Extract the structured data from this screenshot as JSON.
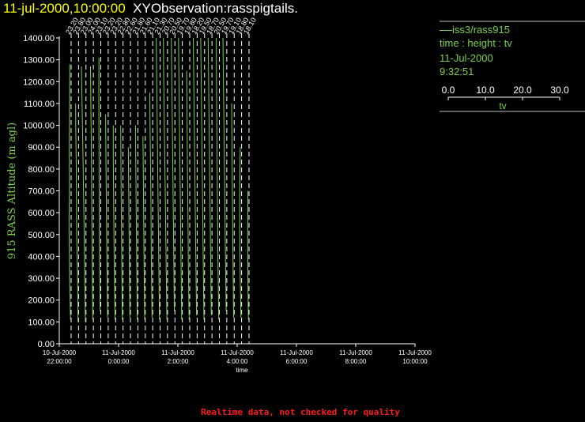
{
  "title": {
    "date": "11-jul-2000,10:00:00",
    "observation": "XYObservation:rasspigtails."
  },
  "legend": {
    "instrument": "iss3/rass915",
    "axes": "time : height : tv",
    "date": "11-Jul-2000",
    "time": "9:32:51",
    "scale_ticks": [
      "0.0",
      "10.0",
      "20.0",
      "30.0"
    ],
    "scale_label": "tv"
  },
  "footer": "Realtime data, not checked for quality",
  "colors": {
    "background": "#000000",
    "trace": "#7ad14a",
    "title_date": "#ffff00",
    "title_observation": "#ffffff",
    "warning": "#ff1a1a",
    "axis_text": "#ffffff",
    "ylabel": "#7ad14a"
  },
  "chart_data": {
    "type": "line",
    "ylabel": "915 RASS Altitude (m agl)",
    "xlabel": "time",
    "ylim": [
      0,
      1400
    ],
    "yticks": [
      "0.00",
      "100.00",
      "200.00",
      "300.00",
      "400.00",
      "500.00",
      "600.00",
      "700.00",
      "800.00",
      "900.00",
      "1000.00",
      "1100.00",
      "1200.00",
      "1300.00",
      "1400.00"
    ],
    "xlim": [
      "2000-07-10 22:00",
      "2000-07-11 10:00"
    ],
    "xticks": [
      {
        "date": "10-Jul-2000",
        "time": "22:00:00"
      },
      {
        "date": "11-Jul-2000",
        "time": "0:00:00"
      },
      {
        "date": "11-Jul-2000",
        "time": "2:00:00"
      },
      {
        "date": "11-Jul-2000",
        "time": "4:00:00"
      },
      {
        "date": "11-Jul-2000",
        "time": "6:00:00"
      },
      {
        "date": "11-Jul-2000",
        "time": "8:00:00"
      },
      {
        "date": "11-Jul-2000",
        "time": "10:00:00"
      }
    ],
    "tv_scale": [
      0,
      30
    ],
    "series": [
      {
        "time": "2000-07-10 22:15",
        "label": "23.20",
        "tv_start": 23.2,
        "profile": [
          [
            0.5,
            110
          ],
          [
            2.5,
            300
          ],
          [
            3.5,
            550
          ],
          [
            2.8,
            700
          ],
          [
            3,
            900
          ],
          [
            2.5,
            1080
          ],
          [
            2,
            1280
          ]
        ]
      },
      {
        "time": "2000-07-10 22:30",
        "label": "23.80",
        "tv_start": 23.8,
        "profile": [
          [
            0.3,
            100
          ],
          [
            1.2,
            300
          ],
          [
            3,
            500
          ],
          [
            3.8,
            800
          ],
          [
            5,
            1000
          ],
          [
            5.2,
            1100
          ]
        ]
      },
      {
        "time": "2000-07-10 22:45",
        "label": "23.00",
        "tv_start": 23.0,
        "profile": [
          [
            0.5,
            100
          ],
          [
            2,
            350
          ],
          [
            3.5,
            600
          ],
          [
            5.5,
            900
          ],
          [
            7,
            1080
          ],
          [
            8.5,
            1270
          ]
        ]
      },
      {
        "time": "2000-07-10 23:00",
        "label": "24.00",
        "tv_start": 24.0,
        "profile": [
          [
            0.5,
            110
          ],
          [
            1.5,
            350
          ],
          [
            2.5,
            600
          ],
          [
            3.5,
            900
          ],
          [
            4.5,
            1150
          ],
          [
            5,
            1270
          ]
        ]
      },
      {
        "time": "2000-07-10 23:15",
        "label": "23.10",
        "tv_start": 23.1,
        "profile": [
          [
            0.5,
            150
          ],
          [
            2,
            400
          ],
          [
            2.5,
            650
          ],
          [
            3,
            900
          ],
          [
            3.2,
            1150
          ],
          [
            3,
            1310
          ]
        ]
      },
      {
        "time": "2000-07-10 23:30",
        "label": "23.20",
        "tv_start": 23.2,
        "profile": [
          [
            0.5,
            120
          ],
          [
            2,
            400
          ],
          [
            3,
            650
          ],
          [
            4,
            900
          ],
          [
            4.5,
            1050
          ]
        ]
      },
      {
        "time": "2000-07-10 23:45",
        "label": "23.20",
        "tv_start": 23.2,
        "profile": [
          [
            0.5,
            110
          ],
          [
            2,
            350
          ],
          [
            3,
            600
          ],
          [
            4,
            850
          ],
          [
            4,
            1000
          ]
        ]
      },
      {
        "time": "2000-07-11 00:00",
        "label": "22.80",
        "tv_start": 22.8,
        "profile": [
          [
            0.5,
            110
          ],
          [
            1.5,
            300
          ],
          [
            2.5,
            550
          ],
          [
            3.5,
            800
          ],
          [
            4,
            1000
          ]
        ]
      },
      {
        "time": "2000-07-11 00:15",
        "label": "22.60",
        "tv_start": 22.6,
        "profile": [
          [
            0.4,
            120
          ],
          [
            1.2,
            300
          ],
          [
            2,
            500
          ],
          [
            3,
            750
          ],
          [
            3.5,
            900
          ]
        ]
      },
      {
        "time": "2000-07-11 00:30",
        "label": "21.80",
        "tv_start": 21.8,
        "profile": [
          [
            0.5,
            110
          ],
          [
            1.5,
            350
          ],
          [
            2.5,
            600
          ],
          [
            3.5,
            850
          ],
          [
            4,
            1000
          ]
        ]
      },
      {
        "time": "2000-07-11 00:45",
        "label": "21.60",
        "tv_start": 21.6,
        "profile": [
          [
            0.5,
            110
          ],
          [
            1.5,
            350
          ],
          [
            2.5,
            600
          ],
          [
            3.5,
            850
          ],
          [
            4,
            950
          ]
        ]
      },
      {
        "time": "2000-07-11 01:00",
        "label": "21.10",
        "tv_start": 21.1,
        "profile": [
          [
            0.5,
            120
          ],
          [
            2,
            400
          ],
          [
            3,
            700
          ],
          [
            4.5,
            1000
          ],
          [
            5,
            1150
          ]
        ]
      },
      {
        "time": "2000-07-11 01:15",
        "label": "21.30",
        "tv_start": 21.3,
        "profile": [
          [
            0.5,
            110
          ],
          [
            2,
            400
          ],
          [
            3.5,
            700
          ],
          [
            5,
            1000
          ],
          [
            6.5,
            1300
          ],
          [
            7,
            1400
          ]
        ]
      },
      {
        "time": "2000-07-11 01:30",
        "label": "20.70",
        "tv_start": 20.7,
        "profile": [
          [
            0.5,
            110
          ],
          [
            2,
            350
          ],
          [
            3.5,
            650
          ],
          [
            5.5,
            950
          ],
          [
            7,
            1250
          ],
          [
            7.5,
            1400
          ]
        ]
      },
      {
        "time": "2000-07-11 01:45",
        "label": "20.50",
        "tv_start": 20.5,
        "profile": [
          [
            0.5,
            150
          ],
          [
            1.5,
            400
          ],
          [
            3,
            700
          ],
          [
            4.5,
            1000
          ],
          [
            6,
            1300
          ],
          [
            6.5,
            1400
          ]
        ]
      },
      {
        "time": "2000-07-11 02:00",
        "label": "19.70",
        "tv_start": 19.7,
        "profile": [
          [
            0.5,
            110
          ],
          [
            2,
            400
          ],
          [
            3.5,
            700
          ],
          [
            5,
            1000
          ],
          [
            6.5,
            1300
          ],
          [
            7,
            1400
          ]
        ]
      },
      {
        "time": "2000-07-11 02:15",
        "label": "19.80",
        "tv_start": 19.8,
        "profile": [
          [
            0.5,
            110
          ],
          [
            2,
            350
          ],
          [
            3,
            600
          ],
          [
            4,
            850
          ],
          [
            5,
            1150
          ],
          [
            5.5,
            1250
          ]
        ]
      },
      {
        "time": "2000-07-11 02:30",
        "label": "18.20",
        "tv_start": 18.2,
        "profile": [
          [
            0.5,
            130
          ],
          [
            2,
            400
          ],
          [
            3.5,
            700
          ],
          [
            5,
            1000
          ],
          [
            6.5,
            1300
          ],
          [
            7,
            1400
          ]
        ]
      },
      {
        "time": "2000-07-11 02:45",
        "label": "19.50",
        "tv_start": 19.5,
        "profile": [
          [
            0.5,
            110
          ],
          [
            2,
            400
          ],
          [
            3.5,
            700
          ],
          [
            5,
            1000
          ],
          [
            6.5,
            1300
          ],
          [
            7,
            1400
          ]
        ]
      },
      {
        "time": "2000-07-11 03:00",
        "label": "18.70",
        "tv_start": 18.7,
        "profile": [
          [
            0.5,
            130
          ],
          [
            2,
            400
          ],
          [
            3.5,
            700
          ],
          [
            5,
            1000
          ],
          [
            6.5,
            1300
          ],
          [
            7,
            1400
          ]
        ]
      },
      {
        "time": "2000-07-11 03:15",
        "label": "20.50",
        "tv_start": 20.5,
        "profile": [
          [
            0.5,
            110
          ],
          [
            2,
            350
          ],
          [
            3,
            600
          ],
          [
            4,
            900
          ],
          [
            5,
            1200
          ],
          [
            5.5,
            1400
          ]
        ]
      },
      {
        "time": "2000-07-11 03:30",
        "label": "19.70",
        "tv_start": 19.7,
        "profile": [
          [
            0.5,
            150
          ],
          [
            2,
            400
          ],
          [
            3.5,
            700
          ],
          [
            5,
            1000
          ],
          [
            6.5,
            1300
          ],
          [
            7,
            1400
          ]
        ]
      },
      {
        "time": "2000-07-11 03:45",
        "label": "19.10",
        "tv_start": 19.1,
        "profile": [
          [
            0.5,
            120
          ],
          [
            1.5,
            350
          ],
          [
            2.5,
            600
          ],
          [
            3.5,
            850
          ],
          [
            4.5,
            1100
          ]
        ]
      },
      {
        "time": "2000-07-11 04:00",
        "label": "18.80",
        "tv_start": 18.8,
        "profile": [
          [
            0.5,
            120
          ],
          [
            2,
            300
          ],
          [
            3,
            500
          ],
          [
            3,
            700
          ],
          [
            2,
            900
          ]
        ]
      },
      {
        "time": "2000-07-11 04:15",
        "label": "18.10",
        "tv_start": 18.1,
        "profile": [
          [
            0.5,
            110
          ],
          [
            1.5,
            300
          ],
          [
            2,
            500
          ],
          [
            1.5,
            700
          ]
        ]
      }
    ]
  }
}
